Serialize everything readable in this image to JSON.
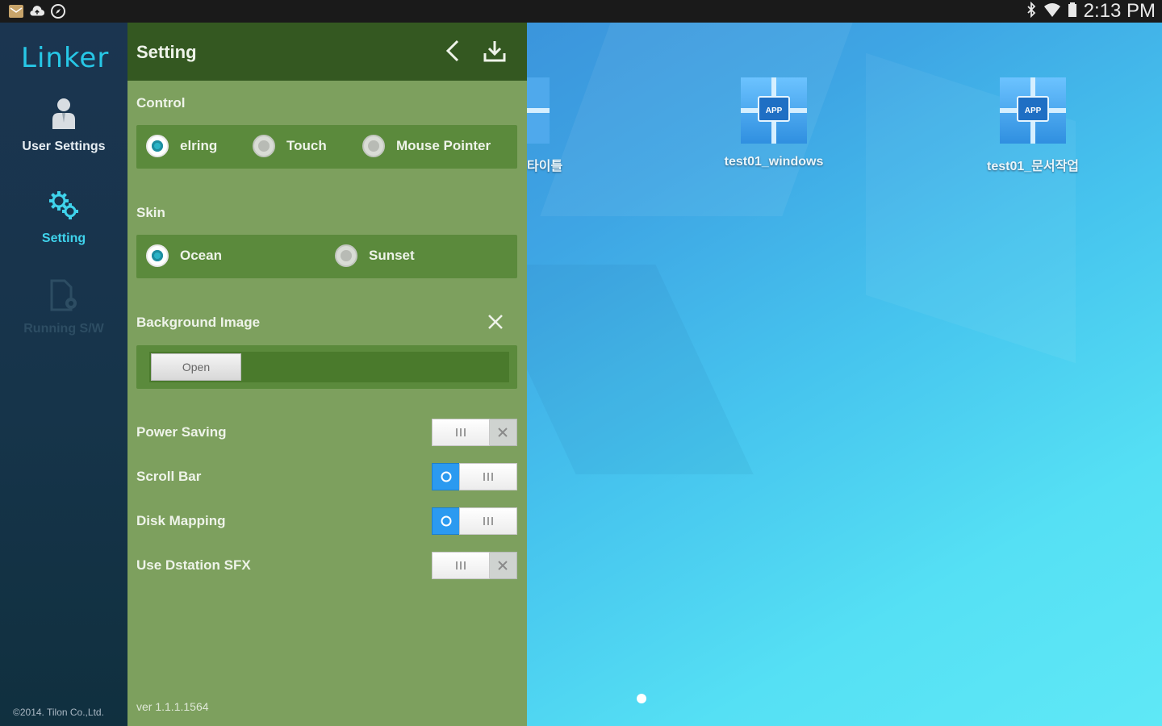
{
  "status_bar": {
    "time": "2:13 PM",
    "left_icons": [
      "mail-icon",
      "cloud-upload-icon",
      "compass-icon"
    ],
    "right_icons": [
      "bluetooth-icon",
      "wifi-icon",
      "battery-icon"
    ]
  },
  "sidebar": {
    "logo": "Linker",
    "items": [
      {
        "label": "User Settings",
        "icon": "user-icon",
        "state": "normal"
      },
      {
        "label": "Setting",
        "icon": "gears-icon",
        "state": "active"
      },
      {
        "label": "Running S/W",
        "icon": "document-gear-icon",
        "state": "disabled"
      }
    ],
    "copyright": "©2014. Tilon Co.,Ltd."
  },
  "panel": {
    "title": "Setting",
    "control": {
      "label": "Control",
      "options": [
        "elring",
        "Touch",
        "Mouse Pointer"
      ],
      "selected": "elring"
    },
    "skin": {
      "label": "Skin",
      "options": [
        "Ocean",
        "Sunset"
      ],
      "selected": "Ocean"
    },
    "background": {
      "label": "Background Image",
      "open_label": "Open"
    },
    "toggles": [
      {
        "label": "Power Saving",
        "on": false
      },
      {
        "label": "Scroll Bar",
        "on": true
      },
      {
        "label": "Disk Mapping",
        "on": true
      },
      {
        "label": "Use Dstation SFX",
        "on": false
      }
    ],
    "version": "ver 1.1.1.1564"
  },
  "desktop": {
    "partial_icon_name": "타이틀",
    "icons": [
      {
        "name": "test01_windows",
        "badge": "APP"
      },
      {
        "name": "test01_문서작업",
        "badge": "APP"
      }
    ]
  },
  "colors": {
    "accent": "#2bb3c6",
    "panel_bg": "#7da05e",
    "panel_header": "#345821",
    "sidebar_bg": "#16344a",
    "toggle_on": "#2b9af0"
  }
}
